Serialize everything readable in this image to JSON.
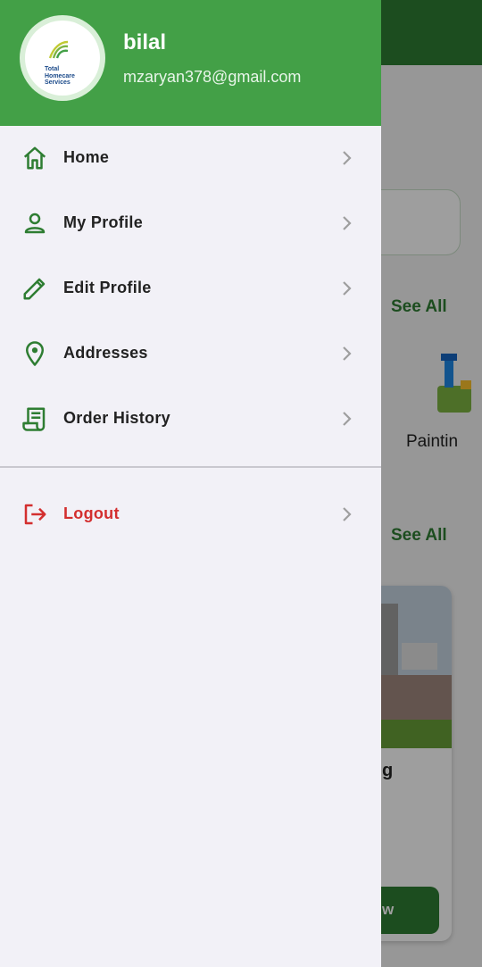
{
  "drawer": {
    "user_name": "bilal",
    "user_email": "mzaryan378@gmail.com",
    "logo_lines": [
      "Total",
      "Homecare",
      "Services"
    ],
    "items": [
      {
        "label": "Home",
        "icon": "home-icon"
      },
      {
        "label": "My Profile",
        "icon": "person-icon"
      },
      {
        "label": "Edit Profile",
        "icon": "pencil-icon"
      },
      {
        "label": "Addresses",
        "icon": "location-pin-icon"
      },
      {
        "label": "Order History",
        "icon": "receipt-icon"
      }
    ],
    "logout": {
      "label": "Logout",
      "icon": "logout-icon"
    }
  },
  "background": {
    "see_all_1": "See All",
    "see_all_2": "See All",
    "category_label": "Paintin",
    "card_title_fragment": "g",
    "card_button_fragment": "w"
  },
  "colors": {
    "header_green": "#43a047",
    "icon_green": "#2e7d32",
    "logout_red": "#d32f2f",
    "drawer_bg": "#f2f1f7"
  }
}
